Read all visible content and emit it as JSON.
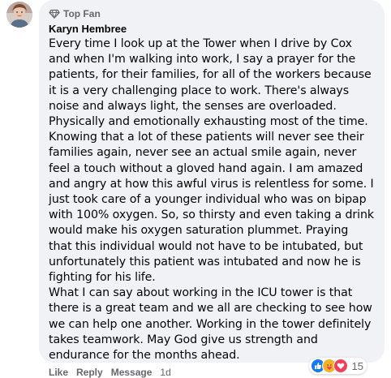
{
  "comment": {
    "badge": "Top Fan",
    "author": "Karyn Hembree",
    "paragraphs": [
      "Every time I look up at the Tower when I drive by Cox and when I'm walking into work, I say a prayer for the patients, for their families, for all of the workers because it is a very challenging place to work. There's always noise and always light, the senses are overloaded. Physically and emotionally exhausting most of the time. Knowing that a lot of these patients will never see their families again, never see an actual smile again, never feel a touch without a gloved hand again. I am amazed and angry at how this awful virus is relentless for some. I just took care of a younger individual who was on bipap with 100% oxygen. So, so thirsty and even taking a drink would make his oxygen saturation plummet. Praying that this individual would not have to be intubated, but unfortunately this patient was intubated and now he is fighting for his life.",
      "What I can say about working in the ICU tower is that there is a great team and we all are checking to see how we can help one another. Working in the tower definitely takes teamwork. May God give us strength and endurance for the months ahead."
    ],
    "reactions": {
      "icons": [
        "like-icon",
        "care-icon",
        "love-icon"
      ],
      "count": "15"
    },
    "actions": {
      "like": "Like",
      "reply": "Reply",
      "message": "Message",
      "time": "1d"
    }
  },
  "colors": {
    "bubble": "#f0f2f5",
    "text": "#050505",
    "secondary_text": "#65676b",
    "like_blue": "#1877f2",
    "love_red": "#f33e58",
    "care_yellow": "#f7b125"
  }
}
